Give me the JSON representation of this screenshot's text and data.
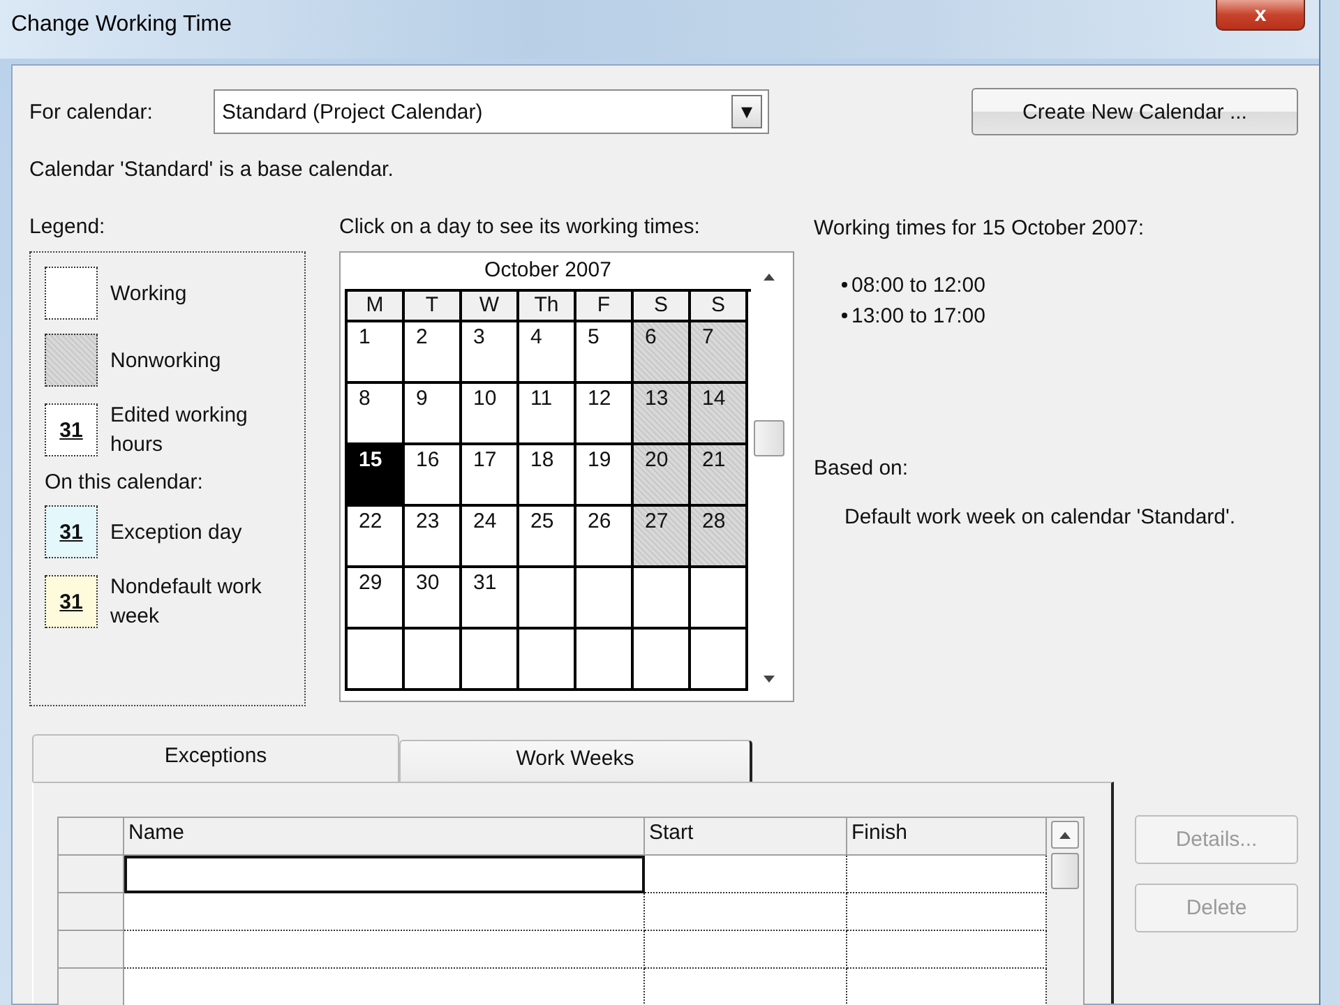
{
  "window": {
    "title": "Change Working Time",
    "close": "x"
  },
  "for_calendar": {
    "label": "For calendar:",
    "value": "Standard (Project Calendar)",
    "dropdown": "▾"
  },
  "create_button": "Create New Calendar ...",
  "calendar_note": "Calendar 'Standard' is a base calendar.",
  "legend": {
    "title": "Legend:",
    "items": [
      {
        "kind": "working",
        "label": "Working"
      },
      {
        "kind": "nonworking",
        "label": "Nonworking"
      },
      {
        "kind": "edited",
        "label": "Edited working hours",
        "swatch_text": "31"
      },
      {
        "kind": "heading",
        "label": "On this calendar:"
      },
      {
        "kind": "exception",
        "label": "Exception day",
        "swatch_text": "31",
        "color": "#e4f7fb"
      },
      {
        "kind": "nondefault",
        "label": "Nondefault work week",
        "swatch_text": "31",
        "color": "#fdfbdc"
      }
    ]
  },
  "calendar": {
    "prompt": "Click on a day to see its working times:",
    "month": "October 2007",
    "weekdays": [
      "M",
      "T",
      "W",
      "Th",
      "F",
      "S",
      "S"
    ],
    "weeks": [
      [
        {
          "kind": "day",
          "day": "1",
          "nonworking": false,
          "selected": false
        },
        {
          "kind": "day",
          "day": "2",
          "nonworking": false,
          "selected": false
        },
        {
          "kind": "day",
          "day": "3",
          "nonworking": false,
          "selected": false
        },
        {
          "kind": "day",
          "day": "4",
          "nonworking": false,
          "selected": false
        },
        {
          "kind": "day",
          "day": "5",
          "nonworking": false,
          "selected": false
        },
        {
          "kind": "day",
          "day": "6",
          "nonworking": true,
          "selected": false
        },
        {
          "kind": "day",
          "day": "7",
          "nonworking": true,
          "selected": false
        }
      ],
      [
        {
          "kind": "day",
          "day": "8",
          "nonworking": false,
          "selected": false
        },
        {
          "kind": "day",
          "day": "9",
          "nonworking": false,
          "selected": false
        },
        {
          "kind": "day",
          "day": "10",
          "nonworking": false,
          "selected": false
        },
        {
          "kind": "day",
          "day": "11",
          "nonworking": false,
          "selected": false
        },
        {
          "kind": "day",
          "day": "12",
          "nonworking": false,
          "selected": false
        },
        {
          "kind": "day",
          "day": "13",
          "nonworking": true,
          "selected": false
        },
        {
          "kind": "day",
          "day": "14",
          "nonworking": true,
          "selected": false
        }
      ],
      [
        {
          "kind": "day",
          "day": "15",
          "nonworking": false,
          "selected": true
        },
        {
          "kind": "day",
          "day": "16",
          "nonworking": false,
          "selected": false
        },
        {
          "kind": "day",
          "day": "17",
          "nonworking": false,
          "selected": false
        },
        {
          "kind": "day",
          "day": "18",
          "nonworking": false,
          "selected": false
        },
        {
          "kind": "day",
          "day": "19",
          "nonworking": false,
          "selected": false
        },
        {
          "kind": "day",
          "day": "20",
          "nonworking": true,
          "selected": false
        },
        {
          "kind": "day",
          "day": "21",
          "nonworking": true,
          "selected": false
        }
      ],
      [
        {
          "kind": "day",
          "day": "22",
          "nonworking": false,
          "selected": false
        },
        {
          "kind": "day",
          "day": "23",
          "nonworking": false,
          "selected": false
        },
        {
          "kind": "day",
          "day": "24",
          "nonworking": false,
          "selected": false
        },
        {
          "kind": "day",
          "day": "25",
          "nonworking": false,
          "selected": false
        },
        {
          "kind": "day",
          "day": "26",
          "nonworking": false,
          "selected": false
        },
        {
          "kind": "day",
          "day": "27",
          "nonworking": true,
          "selected": false
        },
        {
          "kind": "day",
          "day": "28",
          "nonworking": true,
          "selected": false
        }
      ],
      [
        {
          "kind": "day",
          "day": "29",
          "nonworking": false,
          "selected": false
        },
        {
          "kind": "day",
          "day": "30",
          "nonworking": false,
          "selected": false
        },
        {
          "kind": "day",
          "day": "31",
          "nonworking": false,
          "selected": false
        },
        {
          "kind": "blank"
        },
        {
          "kind": "blank"
        },
        {
          "kind": "blank"
        },
        {
          "kind": "blank"
        }
      ],
      [
        {
          "kind": "blank"
        },
        {
          "kind": "blank"
        },
        {
          "kind": "blank"
        },
        {
          "kind": "blank"
        },
        {
          "kind": "blank"
        },
        {
          "kind": "blank"
        },
        {
          "kind": "blank"
        }
      ]
    ]
  },
  "working_times": {
    "title": "Working times for 15 October 2007:",
    "times": [
      "08:00 to 12:00",
      "13:00 to 17:00"
    ],
    "based_on_label": "Based on:",
    "based_on": "Default work week on calendar 'Standard'."
  },
  "tabs": [
    {
      "label": "Exceptions",
      "selected": true
    },
    {
      "label": "Work Weeks",
      "selected": false
    }
  ],
  "exceptions_table": {
    "columns": [
      "Name",
      "Start",
      "Finish"
    ],
    "rows": [
      {
        "focused": true
      },
      {
        "focused": false
      },
      {
        "focused": false
      },
      {
        "focused": false
      }
    ]
  },
  "side_buttons": [
    {
      "label": "Details...",
      "disabled": true
    },
    {
      "label": "Delete",
      "disabled": true
    }
  ]
}
